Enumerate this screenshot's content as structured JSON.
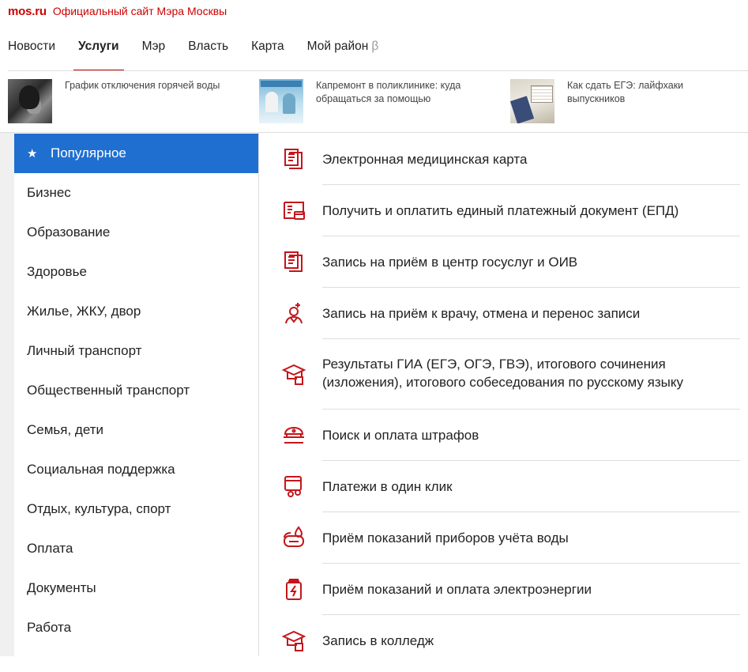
{
  "header": {
    "logo": "mos.ru",
    "site_title": "Официальный сайт Мэра Москвы"
  },
  "nav": [
    {
      "label": "Новости",
      "active": false
    },
    {
      "label": "Услуги",
      "active": true
    },
    {
      "label": "Мэр",
      "active": false
    },
    {
      "label": "Власть",
      "active": false
    },
    {
      "label": "Карта",
      "active": false
    },
    {
      "label": "Мой район",
      "active": false,
      "badge": "β"
    }
  ],
  "news": [
    {
      "text": "График отключения горячей воды"
    },
    {
      "text": "Капремонт в поликлинике: куда обращаться за помощью"
    },
    {
      "text": "Как сдать ЕГЭ: лайфхаки выпускников"
    }
  ],
  "categories": [
    {
      "label": "Популярное",
      "active": true,
      "icon": "star-icon"
    },
    {
      "label": "Бизнес"
    },
    {
      "label": "Образование"
    },
    {
      "label": "Здоровье"
    },
    {
      "label": "Жилье, ЖКУ, двор"
    },
    {
      "label": "Личный транспорт"
    },
    {
      "label": "Общественный транспорт"
    },
    {
      "label": "Семья, дети"
    },
    {
      "label": "Социальная поддержка"
    },
    {
      "label": "Отдых, культура, спорт"
    },
    {
      "label": "Оплата"
    },
    {
      "label": "Документы"
    },
    {
      "label": "Работа"
    }
  ],
  "services": [
    {
      "label": "Электронная медицинская карта",
      "icon": "document-icon"
    },
    {
      "label": "Получить и оплатить единый платежный документ (ЕПД)",
      "icon": "payment-document-icon"
    },
    {
      "label": "Запись на приём в центр госуслуг и ОИВ",
      "icon": "document-icon"
    },
    {
      "label": "Запись на приём к врачу, отмена и перенос записи",
      "icon": "doctor-icon"
    },
    {
      "label": "Результаты ГИА (ЕГЭ, ОГЭ, ГВЭ), итогового сочинения (изложения), итогового собеседования по русскому языку",
      "icon": "graduation-cap-icon"
    },
    {
      "label": "Поиск и оплата штрафов",
      "icon": "police-cap-icon"
    },
    {
      "label": "Платежи в один клик",
      "icon": "one-click-payment-icon"
    },
    {
      "label": "Приём показаний приборов учёта воды",
      "icon": "water-meter-icon"
    },
    {
      "label": "Приём показаний и оплата электроэнергии",
      "icon": "electricity-icon"
    },
    {
      "label": "Запись в колледж",
      "icon": "graduation-cap-icon"
    }
  ],
  "colors": {
    "accent": "#cc0000",
    "active_bg": "#1f6fd1",
    "icon": "#c4161c"
  }
}
